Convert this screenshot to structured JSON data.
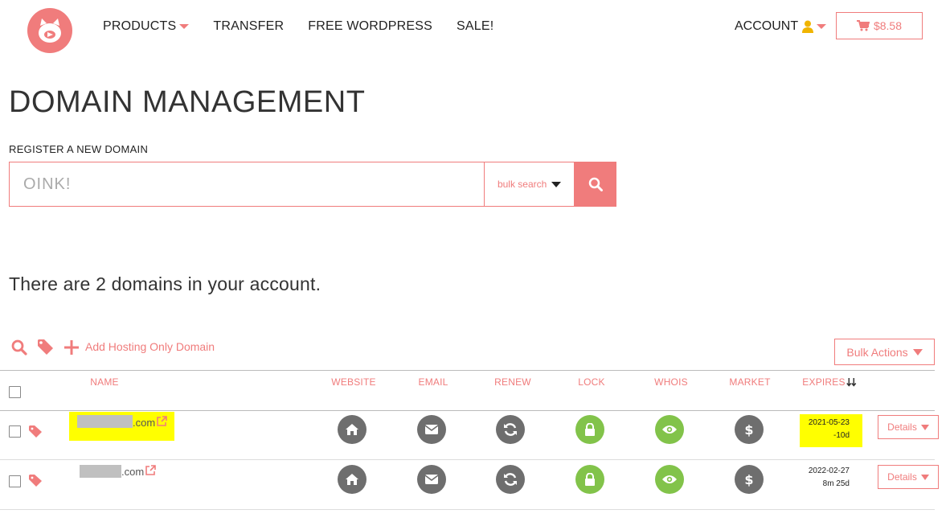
{
  "nav": {
    "products": "PRODUCTS",
    "transfer": "TRANSFER",
    "free_wordpress": "FREE WORDPRESS",
    "sale": "SALE!",
    "account": "ACCOUNT",
    "cart_total": "$8.58"
  },
  "page": {
    "title": "DOMAIN MANAGEMENT",
    "register_label": "REGISTER A NEW DOMAIN",
    "search_placeholder": "OINK!",
    "bulk_search_label": "bulk search",
    "domain_count_text": "There are 2 domains in your account."
  },
  "toolbar": {
    "add_hosting_label": "Add Hosting Only Domain",
    "bulk_actions_label": "Bulk Actions"
  },
  "table": {
    "headers": {
      "name": "NAME",
      "website": "WEBSITE",
      "email": "EMAIL",
      "renew": "RENEW",
      "lock": "LOCK",
      "whois": "WHOIS",
      "market": "MARKET",
      "expires": "EXPIRES"
    },
    "rows": [
      {
        "domain_suffix": ".com",
        "expires_date": "2021-05-23",
        "expires_remaining": "-10d",
        "highlighted": true,
        "details_label": "Details"
      },
      {
        "domain_suffix": ".com",
        "expires_date": "2022-02-27",
        "expires_remaining": "8m 25d",
        "highlighted": false,
        "details_label": "Details"
      }
    ]
  },
  "colors": {
    "accent": "#f07c7c",
    "icon_gray": "#6e6e6e",
    "icon_green": "#82c34a",
    "highlight": "#ffff00",
    "account_icon": "#f0b400"
  },
  "icons": {
    "logo": "pig-logo-icon",
    "account": "user-icon",
    "cart": "cart-icon",
    "search": "search-icon",
    "tag": "tag-icon",
    "add": "plus-icon",
    "external_link": "external-link-icon",
    "website": "home-icon",
    "email": "envelope-icon",
    "renew": "refresh-icon",
    "lock": "lock-icon",
    "whois": "eye-icon",
    "market": "dollar-icon",
    "sort": "sort-icon"
  }
}
